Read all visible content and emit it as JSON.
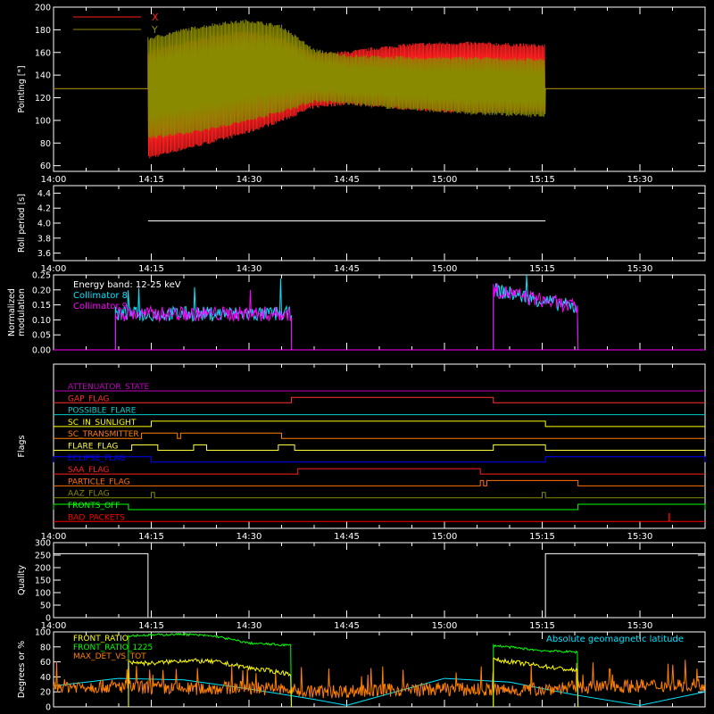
{
  "x_axis": {
    "range_minutes": [
      0,
      100
    ],
    "tick_labels": [
      "14:00",
      "14:15",
      "14:30",
      "14:45",
      "15:00",
      "15:15",
      "15:30"
    ],
    "tick_minutes": [
      0,
      15,
      30,
      45,
      60,
      75,
      90
    ]
  },
  "chart_data": [
    {
      "id": "pointing",
      "type": "line",
      "ylabel": "Pointing [\"]",
      "ylim": [
        55,
        200
      ],
      "y_ticks": [
        60,
        80,
        100,
        120,
        140,
        160,
        180,
        200
      ],
      "x_domain": "minutes after 14:00",
      "series": [
        {
          "name": "X",
          "color": "#ff2020",
          "envelope_minutes": [
            14.5,
            20,
            25,
            30,
            35,
            40,
            45,
            50,
            55,
            60,
            65,
            70,
            75.5
          ],
          "upper": [
            160,
            168,
            175,
            178,
            172,
            158,
            160,
            164,
            167,
            168,
            168,
            167,
            166
          ],
          "lower": [
            67,
            75,
            82,
            90,
            100,
            112,
            115,
            113,
            110,
            108,
            108,
            108,
            108
          ],
          "flat_value": 128
        },
        {
          "name": "Y",
          "color": "#8a8a00",
          "envelope_minutes": [
            14.5,
            20,
            25,
            30,
            35,
            40,
            45,
            50,
            55,
            60,
            65,
            70,
            75.5
          ],
          "upper": [
            172,
            180,
            185,
            188,
            183,
            162,
            157,
            156,
            155,
            155,
            155,
            154,
            154
          ],
          "lower": [
            85,
            88,
            94,
            100,
            108,
            117,
            115,
            112,
            110,
            108,
            106,
            105,
            104
          ],
          "flat_value": 128
        }
      ]
    },
    {
      "id": "roll_period",
      "type": "line",
      "ylabel": "Roll period [s]",
      "ylim": [
        3.5,
        4.5
      ],
      "y_ticks": [
        3.6,
        3.8,
        4.0,
        4.2,
        4.4
      ],
      "series": [
        {
          "name": "",
          "color": "#ffffff",
          "x": [
            14.5,
            75.5
          ],
          "y": [
            4.03,
            4.03
          ]
        }
      ]
    },
    {
      "id": "modulation",
      "type": "line",
      "ylabel": "Normalized modulation",
      "ylim": [
        0,
        0.25
      ],
      "y_ticks": [
        0.0,
        0.05,
        0.1,
        0.15,
        0.2,
        0.25
      ],
      "legend": [
        "Energy band: 12-25 keV",
        "Collimator 8",
        "Collimator 9"
      ],
      "legend_colors": [
        "#ffffff",
        "#00e5ff",
        "#ff00ff"
      ],
      "segments": [
        {
          "x_start": 9.5,
          "x_end": 36.5,
          "level": 0.12
        },
        {
          "x_start": 67.5,
          "x_end": 80.5,
          "level": 0.14
        }
      ],
      "series": [
        {
          "name": "Collimator 8",
          "color": "#00e5ff"
        },
        {
          "name": "Collimator 9",
          "color": "#ff00ff"
        }
      ]
    },
    {
      "id": "flags",
      "type": "line",
      "ylabel": "Flags",
      "rows": [
        {
          "name": "ATTENUATOR_STATE",
          "color": "#c000c0",
          "highs": []
        },
        {
          "name": "GAP_FLAG",
          "color": "#ff3030",
          "highs": [
            [
              36.5,
              67.5
            ]
          ]
        },
        {
          "name": "POSSIBLE_FLARE",
          "color": "#00cccc",
          "highs": []
        },
        {
          "name": "SC_IN_SUNLIGHT",
          "color": "#ffff00",
          "highs": [
            [
              15,
              75.5
            ]
          ]
        },
        {
          "name": "SC_TRANSMITTER",
          "color": "#ff8000",
          "highs": [
            [
              13.5,
              19
            ],
            [
              19.5,
              35
            ]
          ]
        },
        {
          "name": "FLARE_FLAG",
          "color": "#ffff40",
          "highs": [
            [
              12,
              16
            ],
            [
              21.5,
              23.5
            ],
            [
              34.5,
              37
            ],
            [
              67.5,
              75.5
            ]
          ]
        },
        {
          "name": "ECLIPSE_FLAG",
          "color": "#0000ff",
          "highs": [
            [
              0,
              15
            ],
            [
              75.5,
              100
            ]
          ]
        },
        {
          "name": "SAA_FLAG",
          "color": "#ff2020",
          "highs": [
            [
              37.5,
              65.5
            ]
          ]
        },
        {
          "name": "PARTICLE_FLAG",
          "color": "#ff7000",
          "highs": [
            [
              65.5,
              66
            ],
            [
              66.5,
              80.5
            ]
          ]
        },
        {
          "name": "AAZ_FLAG",
          "color": "#8a8a00",
          "highs": [
            [
              15,
              15.5
            ],
            [
              75,
              75.5
            ]
          ]
        },
        {
          "name": "FRONTS_OFF",
          "color": "#00ff00",
          "highs": [
            [
              0,
              11.5
            ],
            [
              80.5,
              100
            ]
          ]
        },
        {
          "name": "BAD_PACKETS",
          "color": "#ff0000",
          "highs": []
        }
      ]
    },
    {
      "id": "quality",
      "type": "line",
      "ylabel": "Quality",
      "ylim": [
        0,
        300
      ],
      "y_ticks": [
        0,
        50,
        100,
        150,
        200,
        250,
        300
      ],
      "series": [
        {
          "name": "",
          "color": "#ffffff",
          "x": [
            0,
            14.5,
            14.5,
            75.5,
            75.5,
            100
          ],
          "y": [
            256,
            256,
            0,
            0,
            256,
            256
          ]
        }
      ]
    },
    {
      "id": "ratios",
      "type": "line",
      "ylabel": "Degrees or %",
      "ylim": [
        0,
        100
      ],
      "y_ticks": [
        0,
        20,
        40,
        60,
        80,
        100
      ],
      "legend": [
        "FRONT_RATIO",
        "FRONT_RATIO_1225",
        "MAX_DET_VS_TOT"
      ],
      "legend_colors": [
        "#ffff00",
        "#00ff00",
        "#ff8000"
      ],
      "right_label": "Absolute geomagnetic latitude",
      "right_label_color": "#00e5ff",
      "series": [
        {
          "name": "FRONT_RATIO",
          "color": "#ffff00",
          "x": [
            11.5,
            15,
            20,
            25,
            30,
            36.5,
            67.5,
            72,
            77,
            80.5
          ],
          "y": [
            60,
            58,
            62,
            60,
            52,
            44,
            63,
            58,
            52,
            48
          ]
        },
        {
          "name": "FRONT_RATIO_1225",
          "color": "#00ff00",
          "x": [
            11.5,
            20,
            25,
            30,
            36.5,
            67.5,
            75,
            80.5
          ],
          "y": [
            95,
            97,
            94,
            85,
            82,
            82,
            75,
            73
          ]
        },
        {
          "name": "MAX_DET_VS_TOT",
          "color": "#ff8000",
          "x": [
            0,
            10,
            20,
            30,
            40,
            50,
            60,
            70,
            80,
            90,
            100
          ],
          "y": [
            28,
            27,
            24,
            26,
            20,
            22,
            24,
            22,
            26,
            28,
            30
          ]
        },
        {
          "name": "Absolute geomagnetic latitude",
          "color": "#00e5ff",
          "x": [
            0,
            10,
            20,
            30,
            40,
            45,
            50,
            60,
            70,
            80,
            90,
            100
          ],
          "y": [
            28,
            38,
            36,
            24,
            10,
            2,
            14,
            38,
            33,
            16,
            2,
            20
          ]
        }
      ]
    }
  ]
}
